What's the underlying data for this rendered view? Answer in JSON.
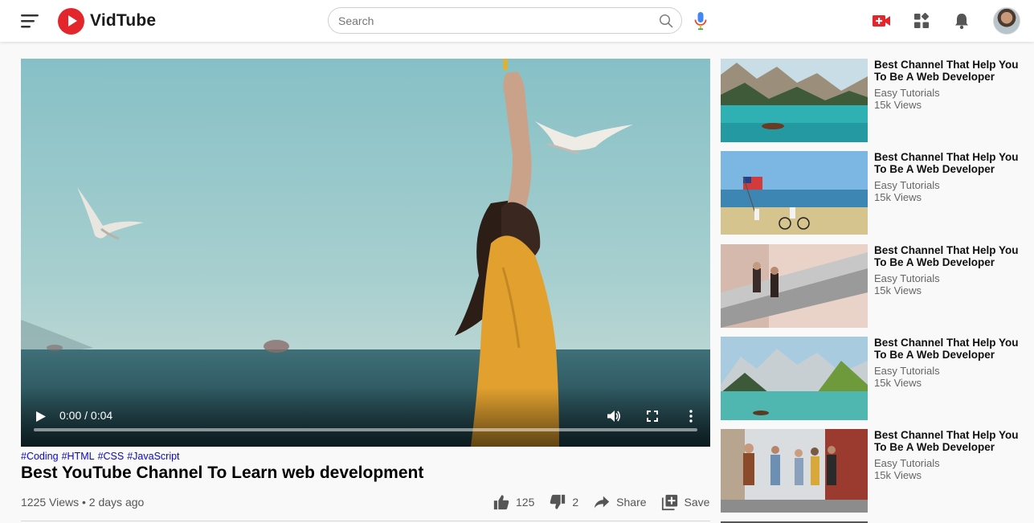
{
  "app": {
    "logo_text": "VidTube"
  },
  "search": {
    "placeholder": "Search"
  },
  "icons": {
    "menu": "menu-icon",
    "search": "search-icon",
    "mic": "microphone-icon",
    "upload": "video-add-icon",
    "apps": "apps-icon",
    "notifications": "bell-icon",
    "avatar": "avatar-icon"
  },
  "colors": {
    "brand": "#e3262b",
    "upload": "#e3262b",
    "tag_link": "#0b07c8"
  },
  "player": {
    "time": "0:00 / 0:04",
    "progress": 0
  },
  "video": {
    "tags": [
      "#Coding",
      "#HTML",
      "#CSS",
      "#JavaScript"
    ],
    "title": "Best YouTube Channel To Learn web development",
    "views_date": "1225 Views • 2 days ago",
    "likes": "125",
    "dislikes": "2",
    "share_label": "Share",
    "save_label": "Save"
  },
  "sidebar": {
    "items": [
      {
        "title": "Best Channel That Help You To Be A Web Developer",
        "channel": "Easy Tutorials",
        "views": "15k Views"
      },
      {
        "title": "Best Channel That Help You To Be A Web Developer",
        "channel": "Easy Tutorials",
        "views": "15k Views"
      },
      {
        "title": "Best Channel That Help You To Be A Web Developer",
        "channel": "Easy Tutorials",
        "views": "15k Views"
      },
      {
        "title": "Best Channel That Help You To Be A Web Developer",
        "channel": "Easy Tutorials",
        "views": "15k Views"
      },
      {
        "title": "Best Channel That Help You To Be A Web Developer",
        "channel": "Easy Tutorials",
        "views": "15k Views"
      }
    ]
  }
}
